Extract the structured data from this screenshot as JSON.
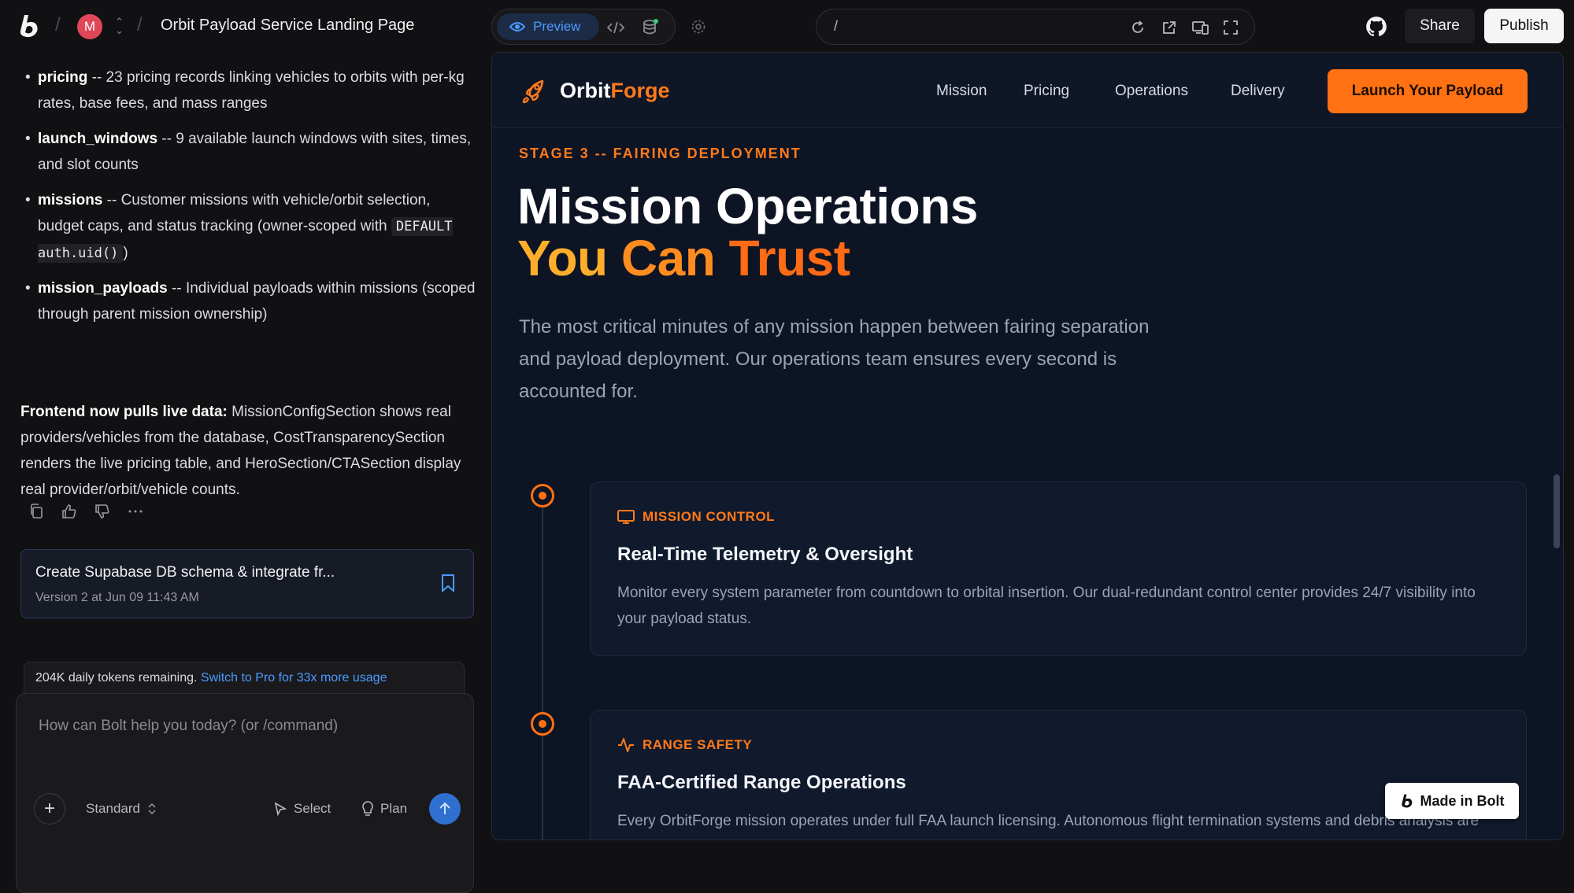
{
  "topbar": {
    "avatar_initial": "M",
    "project_title": "Orbit Payload Service Landing Page",
    "preview_label": "Preview",
    "url_path": "/",
    "share_label": "Share",
    "publish_label": "Publish"
  },
  "chat": {
    "bullets": [
      {
        "term": "pricing",
        "text": " -- 23 pricing records linking vehicles to orbits with per-kg rates, base fees, and mass ranges"
      },
      {
        "term": "launch_windows",
        "text": " -- 9 available launch windows with sites, times, and slot counts"
      },
      {
        "term": "missions",
        "text": " -- Customer missions with vehicle/orbit selection, budget caps, and status tracking (owner-scoped with ",
        "code": "DEFAULT auth.uid()",
        "tail": ")"
      },
      {
        "term": "mission_payloads",
        "text": " -- Individual payloads within missions (scoped through parent mission ownership)"
      }
    ],
    "summary_bold": "Frontend now pulls live data:",
    "summary_text": " MissionConfigSection shows real providers/vehicles from the database, CostTransparencySection renders the live pricing table, and HeroSection/CTASection display real provider/orbit/vehicle counts.",
    "version_title": "Create Supabase DB schema & integrate fr...",
    "version_sub": "Version 2 at Jun 09 11:43 AM",
    "tokens_text": "204K daily tokens remaining.",
    "tokens_link": "Switch to Pro for 33x more usage",
    "input_placeholder": "How can Bolt help you today? (or /command)",
    "mode_label": "Standard",
    "select_label": "Select",
    "plan_label": "Plan"
  },
  "site": {
    "brand_part1": "Orbit",
    "brand_part2": "Forge",
    "nav": [
      "Mission",
      "Pricing",
      "Operations",
      "Delivery"
    ],
    "cta": "Launch Your Payload",
    "eyebrow": "STAGE 3 -- FAIRING DEPLOYMENT",
    "hero_line1": "Mission Operations",
    "hero_line2_w1": "You",
    "hero_line2_w2": "Can",
    "hero_line2_w3": "Trust",
    "hero_sub": "The most critical minutes of any mission happen between fairing separation and payload deployment. Our operations team ensures every second is accounted for.",
    "cards": [
      {
        "tag": "MISSION CONTROL",
        "title": "Real-Time Telemetry & Oversight",
        "text": "Monitor every system parameter from countdown to orbital insertion. Our dual-redundant control center provides 24/7 visibility into your payload status."
      },
      {
        "tag": "RANGE SAFETY",
        "title": "FAA-Certified Range Operations",
        "text": "Every OrbitForge mission operates under full FAA launch licensing. Autonomous flight termination systems and debris analysis are built into every trajectory."
      }
    ],
    "badge": "Made in Bolt"
  },
  "colors": {
    "accent": "#ff7112",
    "link_blue": "#4b9bff"
  }
}
